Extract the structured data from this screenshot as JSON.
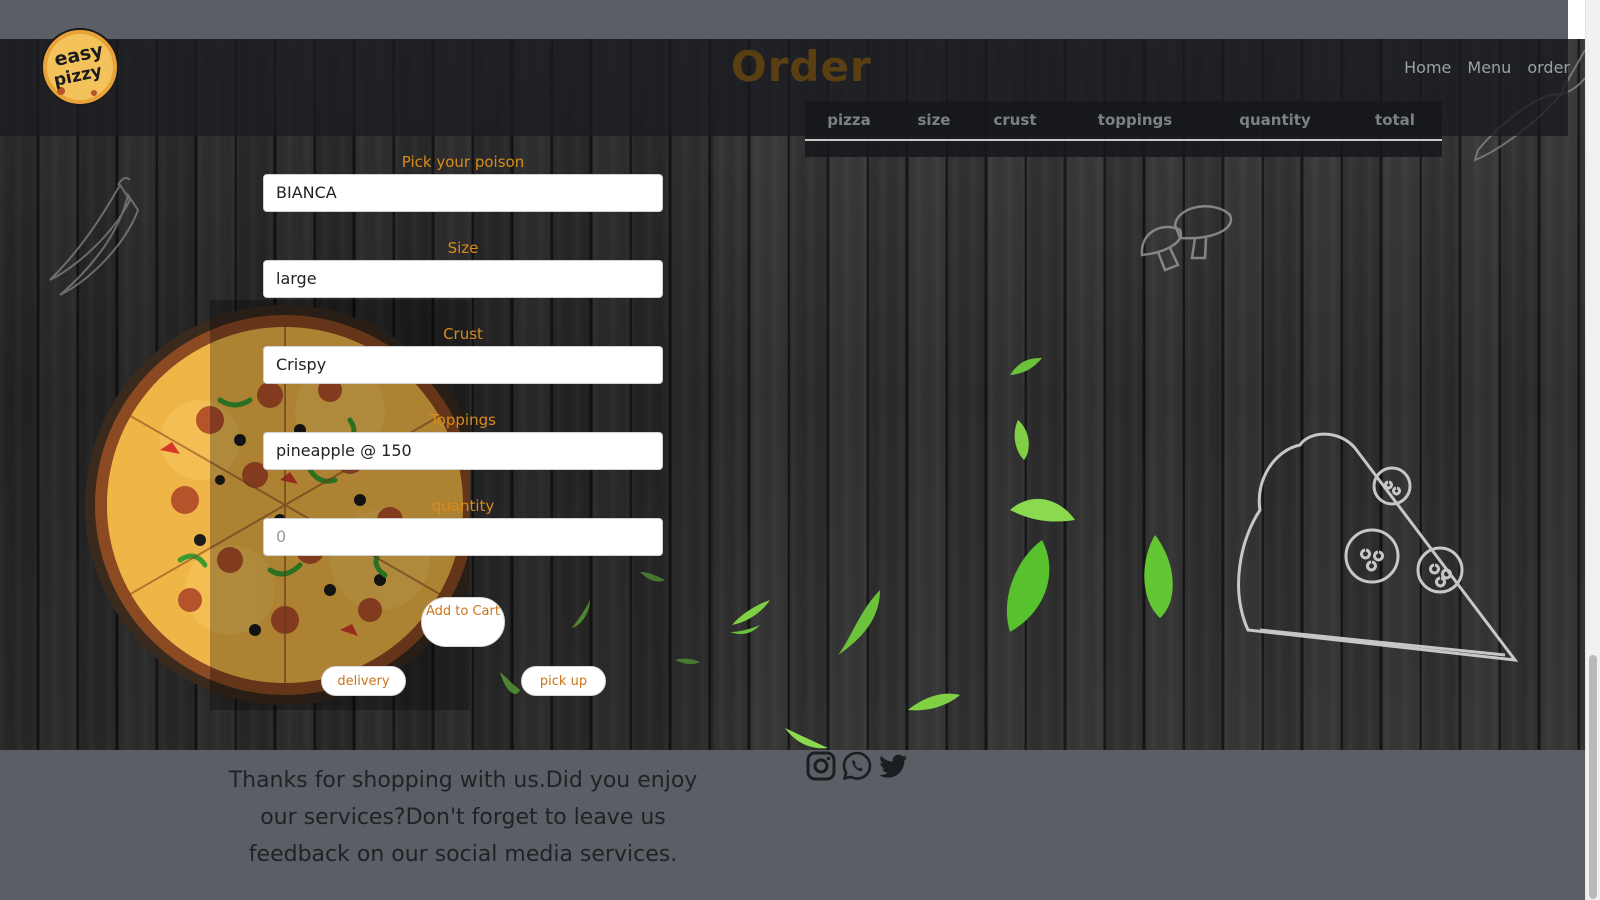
{
  "brand": {
    "logo_line1": "easy",
    "logo_line2": "pizzy"
  },
  "header": {
    "title": "Order"
  },
  "nav": {
    "items": [
      "Home",
      "Menu",
      "order"
    ]
  },
  "order_table": {
    "columns": [
      "pizza",
      "size",
      "crust",
      "toppings",
      "quantity",
      "total"
    ],
    "rows": []
  },
  "form": {
    "pizza": {
      "label": "Pick your poison",
      "value": "BIANCA"
    },
    "size": {
      "label": "Size",
      "value": "large"
    },
    "crust": {
      "label": "Crust",
      "value": "Crispy"
    },
    "toppings": {
      "label": "Toppings",
      "value": "pineapple @ 150"
    },
    "quantity": {
      "label": "quantity",
      "placeholder": "0"
    },
    "add_to_cart": "Add to Cart",
    "delivery": "delivery",
    "pick_up": "pick up"
  },
  "footer": {
    "message": "Thanks for shopping with us.Did you enjoy our services?Don't forget to leave us feedback on our social media services.",
    "social": [
      "instagram-icon",
      "whatsapp-icon",
      "twitter-icon"
    ]
  },
  "colors": {
    "accent": "#d98c1c",
    "title": "#5a3f12",
    "footer_bg": "#5b5e64"
  }
}
